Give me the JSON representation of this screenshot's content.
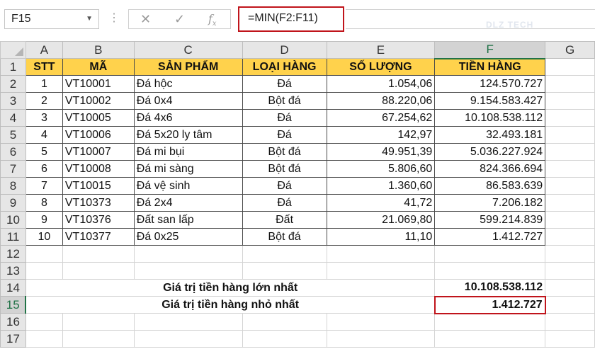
{
  "formula_bar": {
    "name_box": "F15",
    "formula": "=MIN(F2:F11)",
    "watermark": "DLZ TECH"
  },
  "columns": [
    "A",
    "B",
    "C",
    "D",
    "E",
    "F",
    "G"
  ],
  "active_column": "F",
  "active_row": "15",
  "headers": {
    "stt": "STT",
    "ma": "MÃ",
    "san_pham": "SẢN PHẨM",
    "loai_hang": "LOẠI HÀNG",
    "so_luong": "SỐ LƯỢNG",
    "tien_hang": "TIỀN HÀNG"
  },
  "rows": [
    {
      "row": "2",
      "stt": "1",
      "ma": "VT10001",
      "san_pham": "Đá hộc",
      "loai": "Đá",
      "so_luong": "1.054,06",
      "tien": "124.570.727"
    },
    {
      "row": "3",
      "stt": "2",
      "ma": "VT10002",
      "san_pham": "Đá 0x4",
      "loai": "Bột đá",
      "so_luong": "88.220,06",
      "tien": "9.154.583.427"
    },
    {
      "row": "4",
      "stt": "3",
      "ma": "VT10005",
      "san_pham": "Đá 4x6",
      "loai": "Đá",
      "so_luong": "67.254,62",
      "tien": "10.108.538.112"
    },
    {
      "row": "5",
      "stt": "4",
      "ma": "VT10006",
      "san_pham": "Đá 5x20 ly tâm",
      "loai": "Đá",
      "so_luong": "142,97",
      "tien": "32.493.181"
    },
    {
      "row": "6",
      "stt": "5",
      "ma": "VT10007",
      "san_pham": "Đá mi bụi",
      "loai": "Bột đá",
      "so_luong": "49.951,39",
      "tien": "5.036.227.924"
    },
    {
      "row": "7",
      "stt": "6",
      "ma": "VT10008",
      "san_pham": "Đá mi sàng",
      "loai": "Bột đá",
      "so_luong": "5.806,60",
      "tien": "824.366.694"
    },
    {
      "row": "8",
      "stt": "7",
      "ma": "VT10015",
      "san_pham": "Đá vệ sinh",
      "loai": "Đá",
      "so_luong": "1.360,60",
      "tien": "86.583.639"
    },
    {
      "row": "9",
      "stt": "8",
      "ma": "VT10373",
      "san_pham": "Đá 2x4",
      "loai": "Đá",
      "so_luong": "41,72",
      "tien": "7.206.182"
    },
    {
      "row": "10",
      "stt": "9",
      "ma": "VT10376",
      "san_pham": "Đất san lấp",
      "loai": "Đất",
      "so_luong": "21.069,80",
      "tien": "599.214.839"
    },
    {
      "row": "11",
      "stt": "10",
      "ma": "VT10377",
      "san_pham": "Đá 0x25",
      "loai": "Bột đá",
      "so_luong": "11,10",
      "tien": "1.412.727"
    }
  ],
  "empty_rows": [
    "12",
    "13",
    "16",
    "17"
  ],
  "summary": {
    "max": {
      "row": "14",
      "label": "Giá trị tiền hàng lớn nhất",
      "value": "10.108.538.112"
    },
    "min": {
      "row": "15",
      "label": "Giá trị tiền hàng nhỏ nhất",
      "value": "1.412.727"
    }
  },
  "colors": {
    "header_fill": "#ffd24c",
    "highlight_border": "#c0141b",
    "active_header_text": "#1e7145"
  },
  "icons": {
    "cancel": "close-icon",
    "enter": "check-icon",
    "function": "fx-icon"
  }
}
